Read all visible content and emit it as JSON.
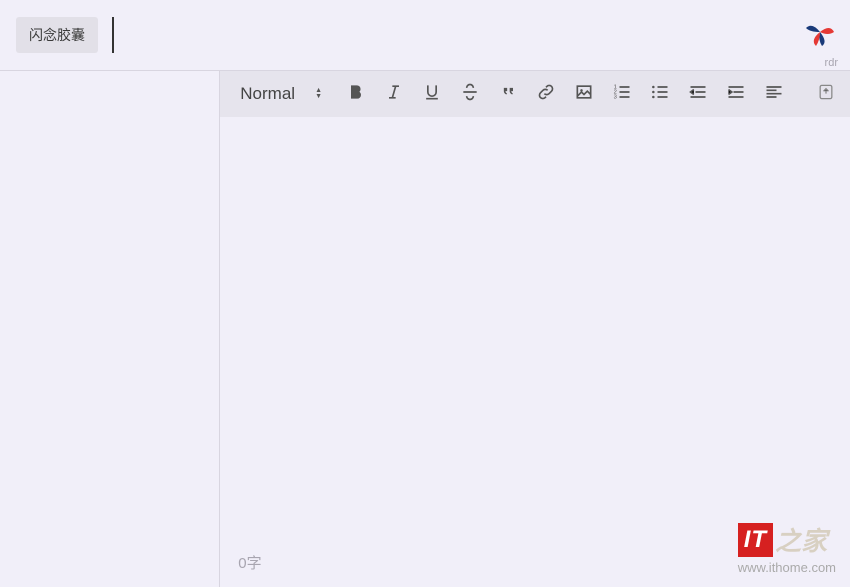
{
  "header": {
    "capsule_label": "闪念胶囊",
    "title_value": "",
    "username": "rdr"
  },
  "toolbar": {
    "format_label": "Normal"
  },
  "editor": {
    "word_count": "0字"
  },
  "watermark": {
    "brand_box": "IT",
    "brand_suffix": "之家",
    "url": "www.ithome.com"
  }
}
